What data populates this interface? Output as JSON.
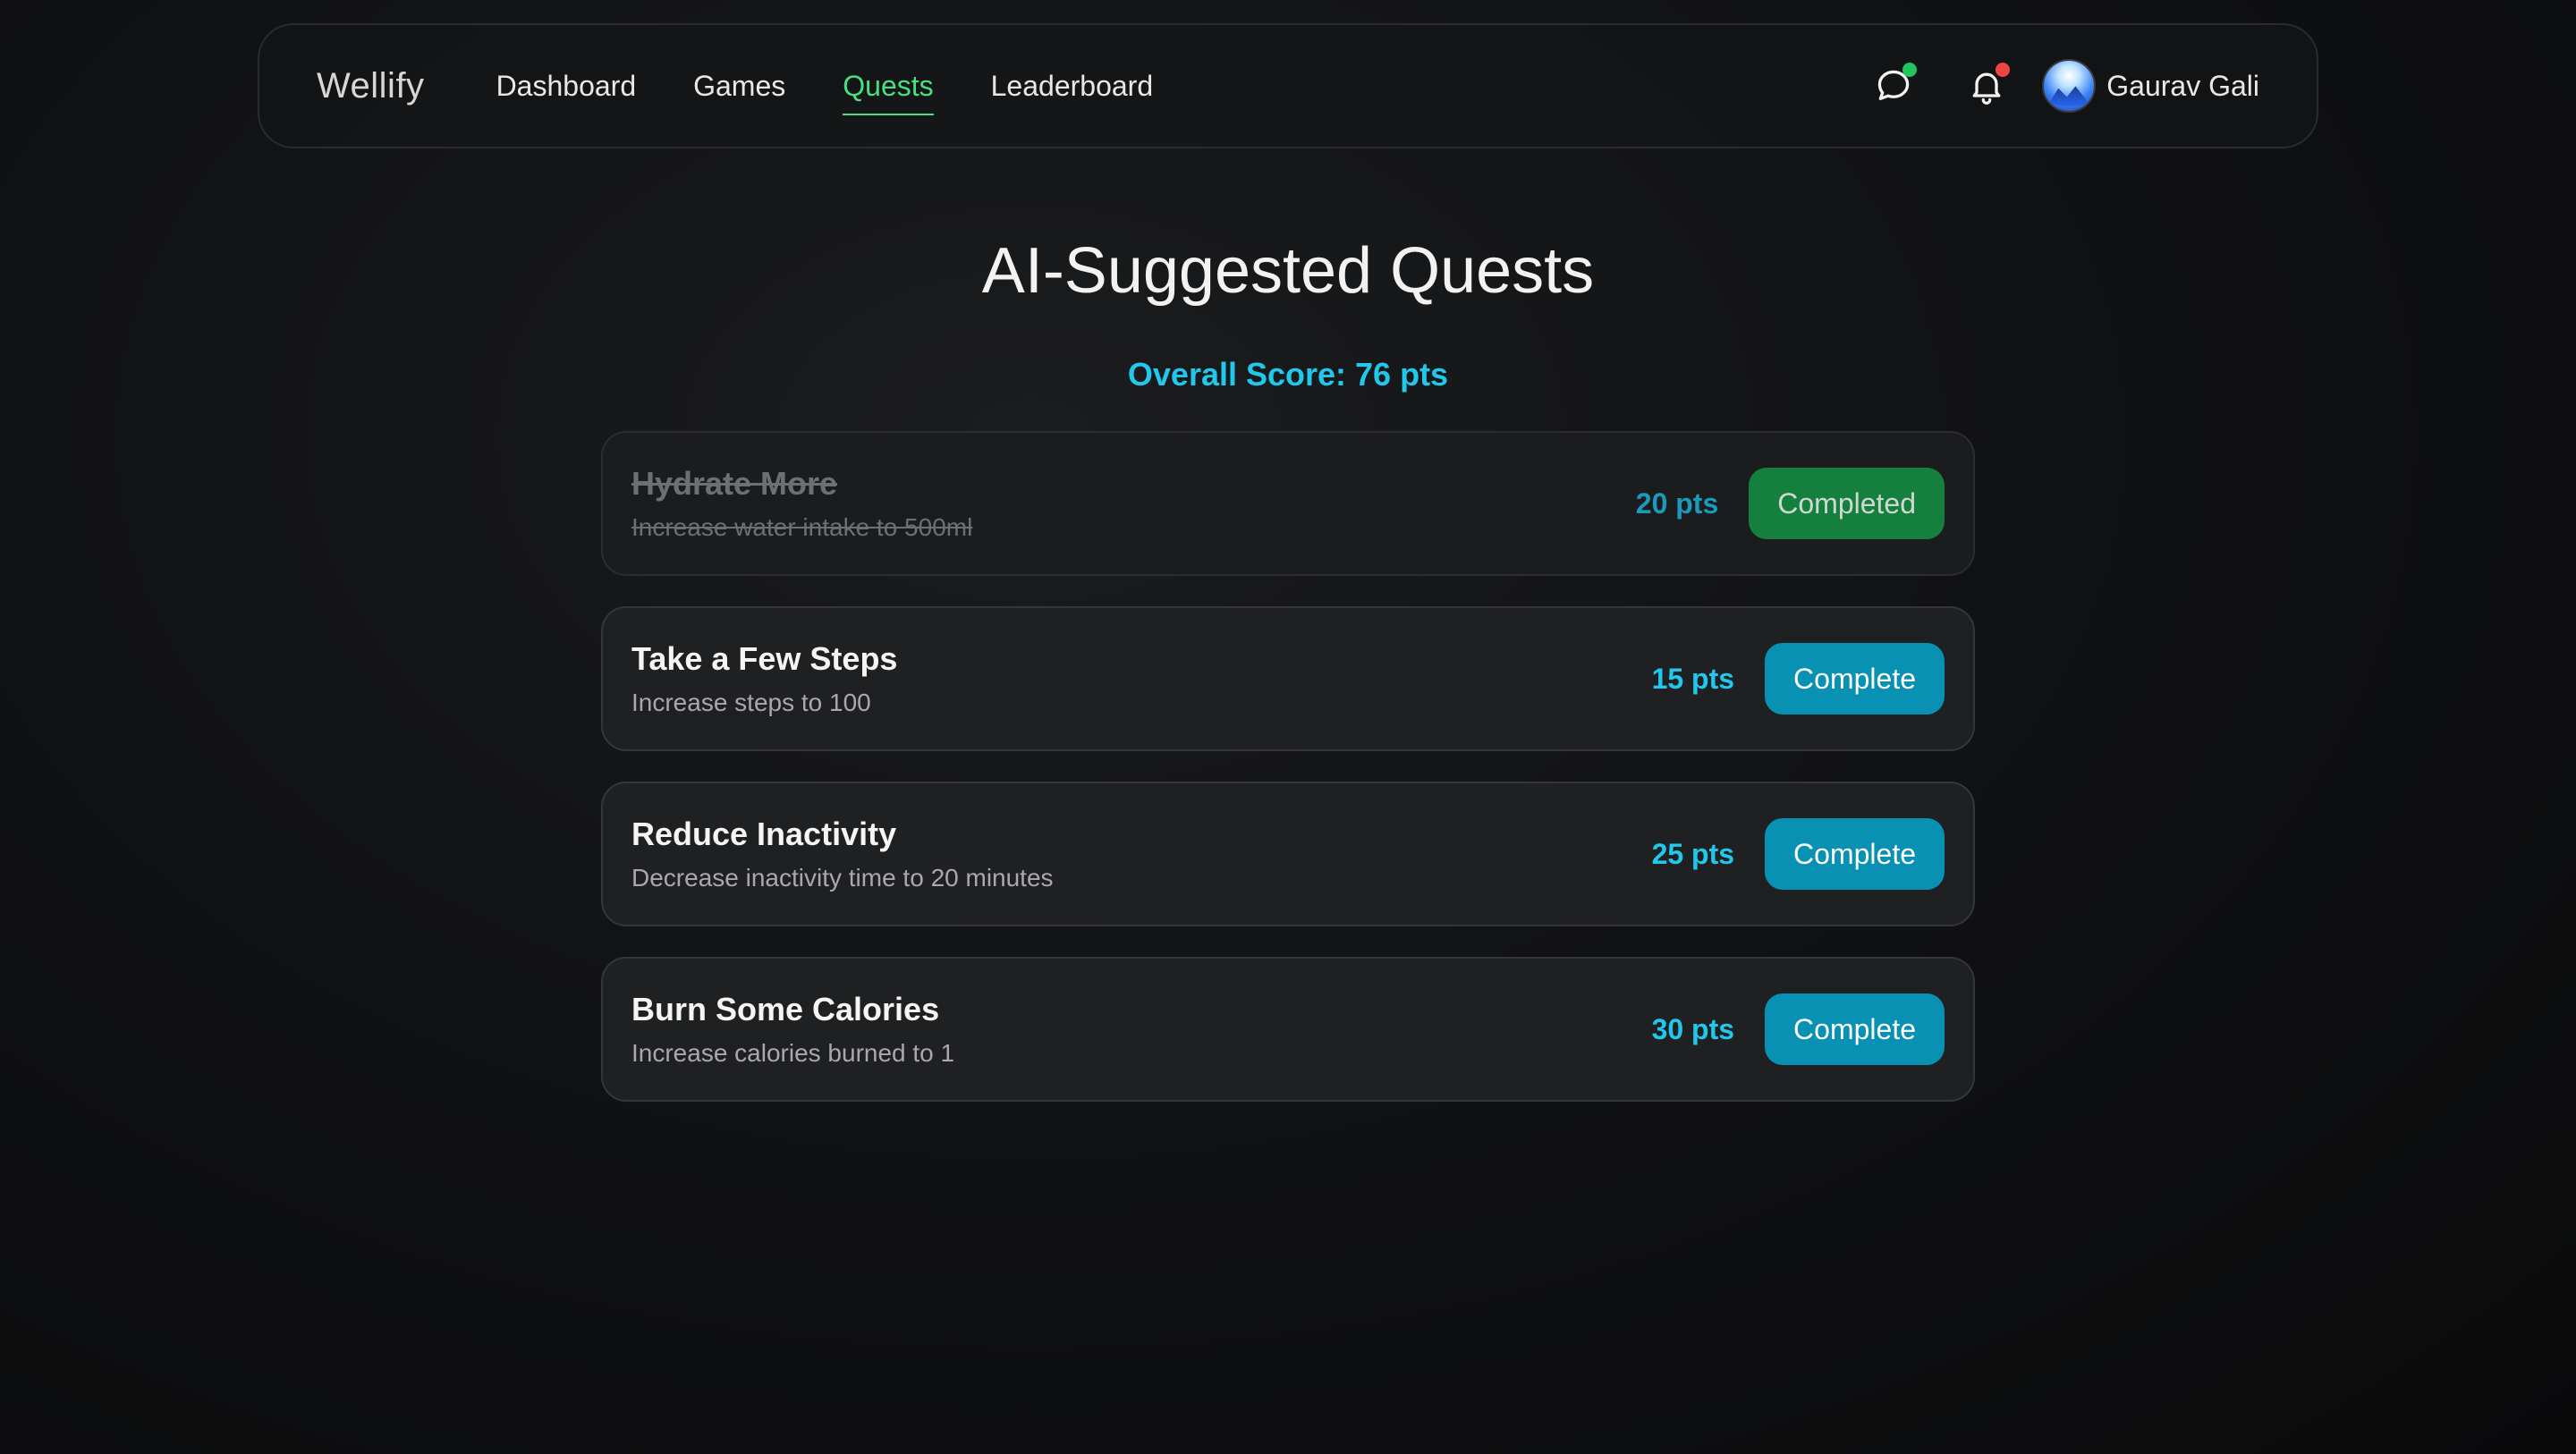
{
  "nav": {
    "brand": "Wellify",
    "links": [
      {
        "label": "Dashboard",
        "active": false
      },
      {
        "label": "Games",
        "active": false
      },
      {
        "label": "Quests",
        "active": true
      },
      {
        "label": "Leaderboard",
        "active": false
      }
    ],
    "icons": {
      "chat": "chat-bubble-icon",
      "bell": "bell-icon"
    },
    "chat_indicator_color": "#22c55e",
    "bell_indicator_color": "#ef4444",
    "user_name": "Gaurav Gali"
  },
  "page": {
    "title": "AI-Suggested Quests",
    "score": "Overall Score: 76 pts"
  },
  "quests": [
    {
      "title": "Hydrate More",
      "desc": "Increase water intake to 500ml",
      "pts": "20 pts",
      "button": "Completed",
      "done": true
    },
    {
      "title": "Take a Few Steps",
      "desc": "Increase steps to 100",
      "pts": "15 pts",
      "button": "Complete",
      "done": false
    },
    {
      "title": "Reduce Inactivity",
      "desc": "Decrease inactivity time to 20 minutes",
      "pts": "25 pts",
      "button": "Complete",
      "done": false
    },
    {
      "title": "Burn Some Calories",
      "desc": "Increase calories burned to 1",
      "pts": "30 pts",
      "button": "Complete",
      "done": false
    }
  ],
  "colors": {
    "accent_active": "#4ade80",
    "score": "#22c7ec",
    "complete_button": "#0891b2",
    "completed_button": "#15803d"
  }
}
